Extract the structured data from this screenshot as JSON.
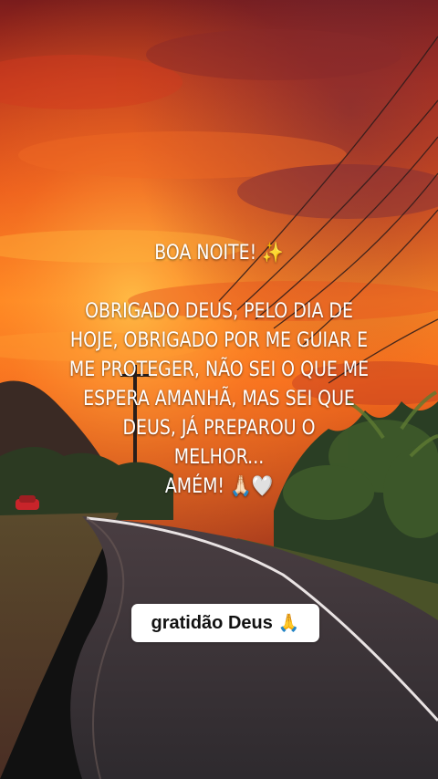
{
  "caption": {
    "title": "BOA NOITE! ✨",
    "body_lines": [
      "OBRIGADO DEUS, PELO DIA DE",
      "HOJE, OBRIGADO POR ME GUIAR E",
      "ME PROTEGER, NÃO SEI O QUE ME",
      "ESPERA AMANHÃ, MAS SEI QUE",
      "DEUS, JÁ PREPAROU O",
      "MELHOR...",
      "AMÉM! 🙏🏻🤍"
    ]
  },
  "badge": {
    "text": "gratidão Deus",
    "emoji": "🙏"
  },
  "colors": {
    "sky_top": "#c0301a",
    "sky_glow": "#ff7a1a",
    "road": "#3a3436",
    "caption_text": "#ffffff",
    "badge_bg": "#ffffff"
  }
}
